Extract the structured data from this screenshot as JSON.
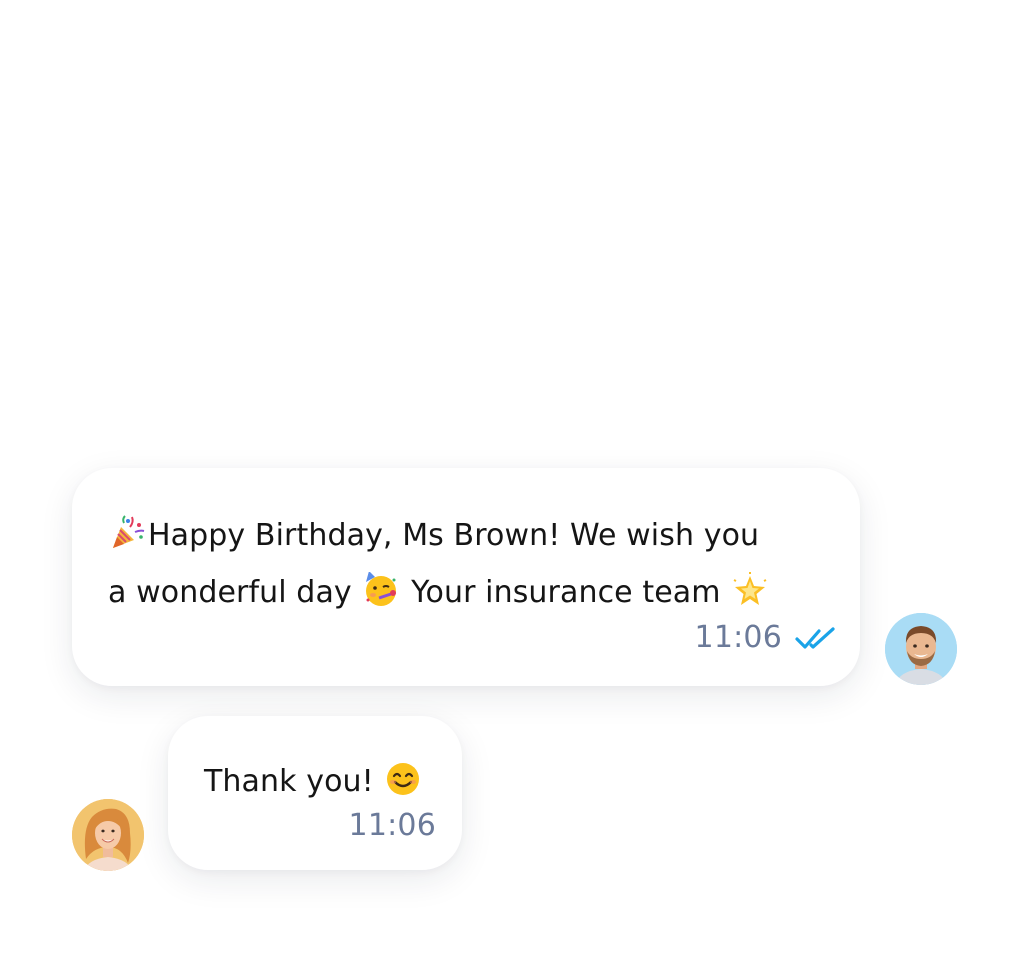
{
  "chat": {
    "messages": [
      {
        "direction": "outgoing",
        "line1_text": "Happy Birthday, Ms Brown! We wish you",
        "line2_text_a": "a wonderful day",
        "line2_text_b": "Your insurance team",
        "time": "11:06",
        "status": "read",
        "icons": [
          "party-popper-icon",
          "partying-face-icon",
          "glowing-star-icon",
          "double-check-icon"
        ],
        "avatar": "agent-avatar"
      },
      {
        "direction": "incoming",
        "text": "Thank you!",
        "time": "11:06",
        "icons": [
          "smiling-face-icon"
        ],
        "avatar": "customer-avatar"
      }
    ]
  },
  "colors": {
    "text": "#151515",
    "timestamp": "#6b7a99",
    "read_check": "#1aa3e8",
    "bubble": "#ffffff"
  }
}
